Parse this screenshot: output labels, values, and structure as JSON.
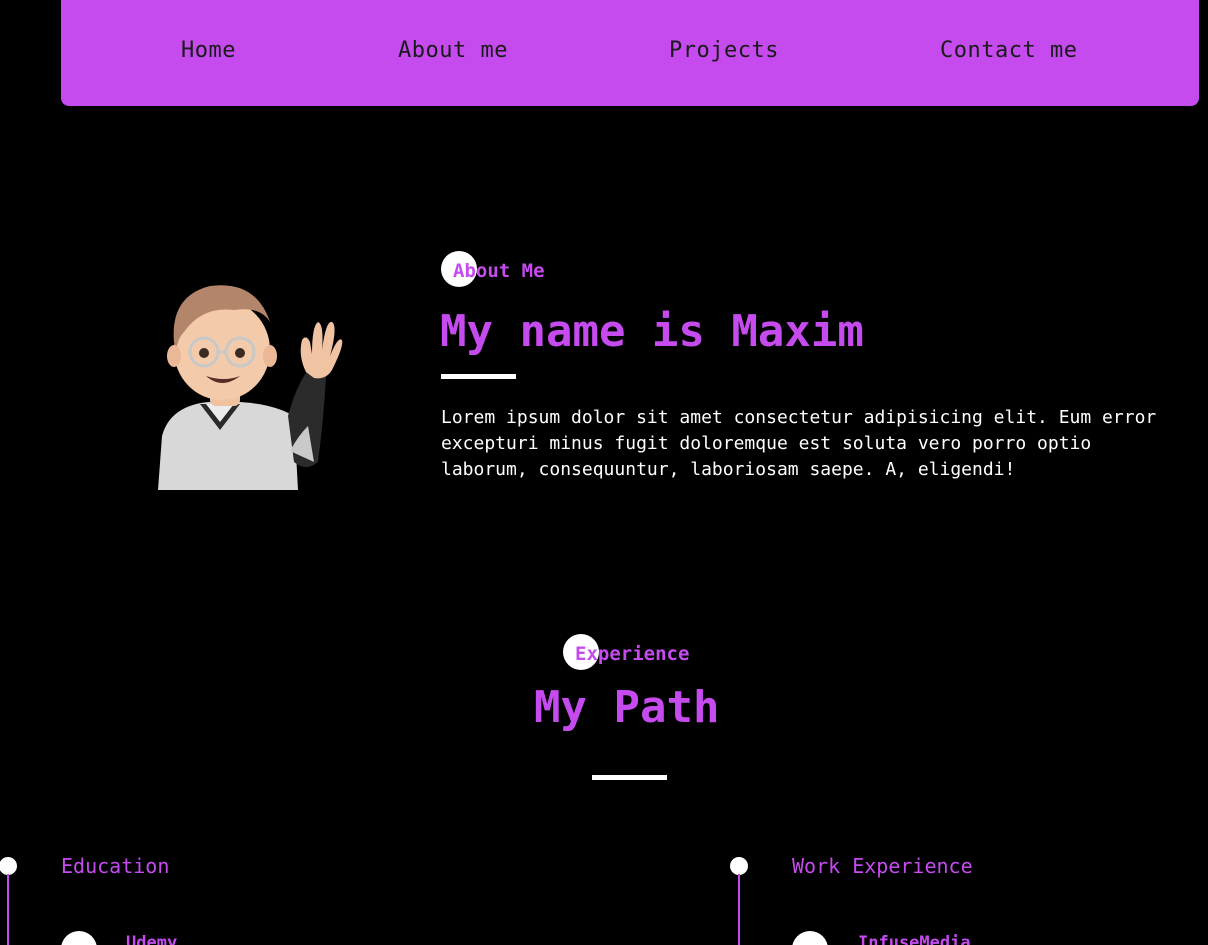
{
  "nav": {
    "items": [
      "Home",
      "About me",
      "Projects",
      "Contact me"
    ]
  },
  "about": {
    "tag": "About Me",
    "title": "My name is Maxim",
    "text": "Lorem ipsum dolor sit amet consectetur adipisicing elit. Eum error excepturi minus fugit doloremque est soluta vero porro optio laborum, consequuntur, laboriosam saepe. A, eligendi!",
    "avatar_icon": "waving-memoji-avatar"
  },
  "experience": {
    "tag": "Experience",
    "title": "My Path",
    "education": {
      "title": "Education",
      "items": [
        "Udemy"
      ]
    },
    "work": {
      "title": "Work Experience",
      "items": [
        "InfuseMedia"
      ]
    }
  },
  "colors": {
    "accent": "#c54bef",
    "background": "#000000",
    "text": "#ffffff"
  }
}
